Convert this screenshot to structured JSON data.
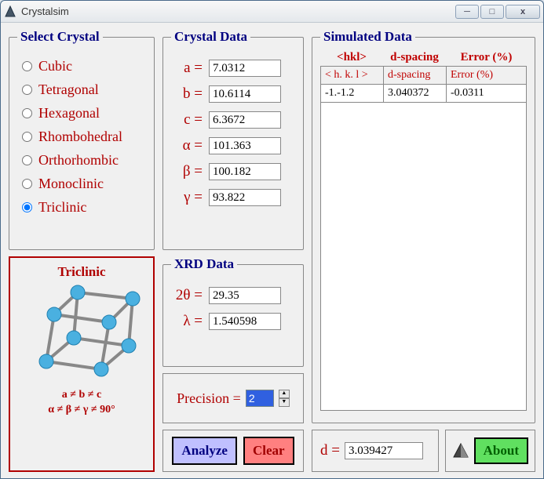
{
  "window": {
    "title": "Crystalsim"
  },
  "select_crystal": {
    "legend": "Select Crystal",
    "options": [
      "Cubic",
      "Tetragonal",
      "Hexagonal",
      "Rhombohedral",
      "Orthorhombic",
      "Monoclinic",
      "Triclinic"
    ],
    "selected": "Triclinic"
  },
  "crystal_data": {
    "legend": "Crystal Data",
    "fields": [
      {
        "label": "a =",
        "value": "7.0312"
      },
      {
        "label": "b =",
        "value": "10.6114"
      },
      {
        "label": "c =",
        "value": "6.3672"
      },
      {
        "label": "α =",
        "value": "101.363"
      },
      {
        "label": "β =",
        "value": "100.182"
      },
      {
        "label": "γ =",
        "value": "93.822"
      }
    ]
  },
  "xrd_data": {
    "legend": "XRD Data",
    "fields": [
      {
        "label": "2θ =",
        "value": "29.35"
      },
      {
        "label": "λ =",
        "value": "1.540598"
      }
    ]
  },
  "precision": {
    "label": "Precision =",
    "value": "2"
  },
  "simulated": {
    "legend": "Simulated Data",
    "headers_top": [
      "<hkl>",
      "d-spacing",
      "Error (%)"
    ],
    "headers": [
      "< h. k. l >",
      "d-spacing",
      "Error (%)"
    ],
    "rows": [
      {
        "hkl": "-1.-1.2",
        "d": "3.040372",
        "err": "-0.0311"
      }
    ]
  },
  "buttons": {
    "analyze": "Analyze",
    "clear": "Clear",
    "about": "About"
  },
  "d_result": {
    "label": "d =",
    "value": "3.039427"
  },
  "diagram": {
    "title": "Triclinic",
    "eq1": "a ≠ b ≠ c",
    "eq2": "α ≠ β ≠ γ ≠ 90°"
  }
}
